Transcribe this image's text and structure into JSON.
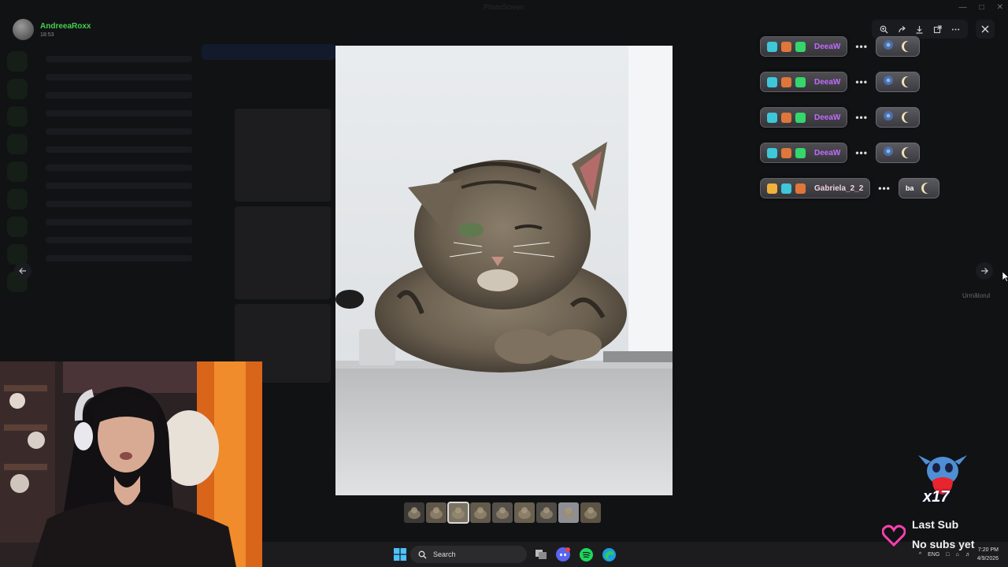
{
  "viewer": {
    "user_name": "AndreeaRoxx",
    "timestamp": "18:53",
    "window_title": "PhotoScreen"
  },
  "toolbar": {
    "icons": [
      "zoom-in-icon",
      "forward-icon",
      "download-icon",
      "open-external-icon",
      "more-icon",
      "close-icon"
    ]
  },
  "navigation": {
    "next_tooltip": "Următorul"
  },
  "chat_overlay": {
    "rows": [
      {
        "name": "DeeaW",
        "name_color": "#c26bff",
        "badges": [
          "#3ec6d9",
          "#e0763a",
          "#35d66b"
        ]
      },
      {
        "name": "DeeaW",
        "name_color": "#c26bff",
        "badges": [
          "#3ec6d9",
          "#e0763a",
          "#35d66b"
        ]
      },
      {
        "name": "DeeaW",
        "name_color": "#c26bff",
        "badges": [
          "#3ec6d9",
          "#e0763a",
          "#35d66b"
        ]
      },
      {
        "name": "DeeaW",
        "name_color": "#c26bff",
        "badges": [
          "#3ec6d9",
          "#e0763a",
          "#35d66b"
        ]
      },
      {
        "name": "Gabriela_2_2",
        "name_color": "#f0d2e0",
        "badges": [
          "#f0b23a",
          "#3ec6d9",
          "#e0763a"
        ],
        "message": "ba"
      }
    ]
  },
  "thumbnails": {
    "count": 9,
    "active_index": 2
  },
  "taskbar": {
    "search_placeholder": "Search",
    "language": "ENG",
    "time": "7:20 PM",
    "date": "4/9/2026"
  },
  "sub_widget": {
    "count": "x17",
    "title": "Last Sub",
    "value": "No subs yet"
  },
  "colors": {
    "accent_green": "#45d14f",
    "heart": "#ff3fb0"
  }
}
